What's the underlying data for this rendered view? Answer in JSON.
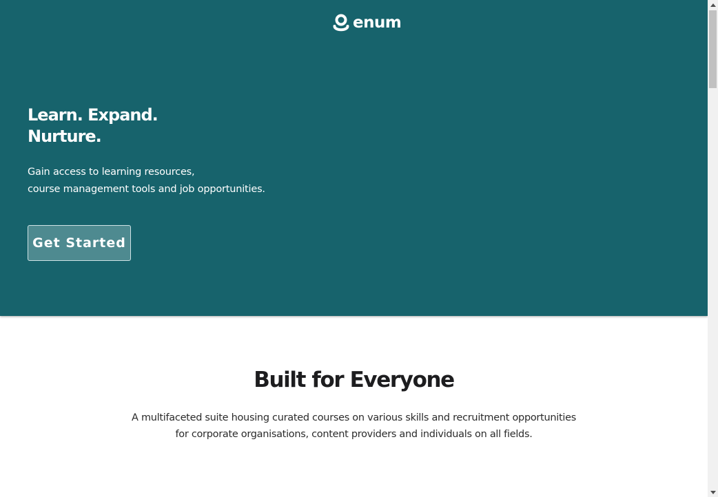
{
  "brand": {
    "name": "enum",
    "icon": "enum-logo-icon"
  },
  "hero": {
    "headline_line1": "Learn. Expand.",
    "headline_line2": "Nurture.",
    "subtext_line1": "Gain access to learning resources,",
    "subtext_line2": "course management tools and job opportunities.",
    "cta_label": "Get Started",
    "background_color": "#17636c"
  },
  "features": {
    "title": "Built for Everyone",
    "desc_line1": "A multifaceted suite housing curated courses on various skills and recruitment opportunities",
    "desc_line2": "for corporate organisations, content providers and individuals on all fields."
  },
  "scrollbar": {
    "up_icon": "scroll-up-arrow-icon",
    "down_icon": "scroll-down-arrow-icon"
  }
}
